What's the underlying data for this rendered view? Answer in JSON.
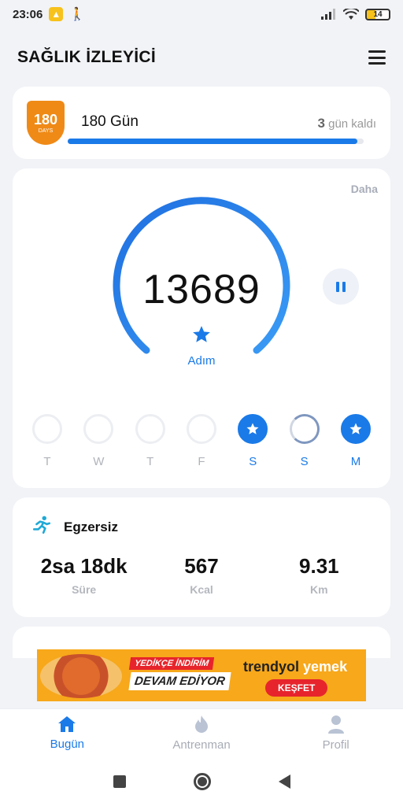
{
  "status_bar": {
    "time": "23:06",
    "battery": "14"
  },
  "header": {
    "title": "SAĞLIK İZLEYİCİ",
    "menu_icon": "hamburger-menu-icon"
  },
  "challenge": {
    "badge_number": "180",
    "badge_sub": "DAYS",
    "title": "180 Gün",
    "remaining_count": "3",
    "remaining_text": "gün kaldı",
    "progress": 0.98
  },
  "steps": {
    "more_label": "Daha",
    "count": "13689",
    "label": "Adım",
    "gauge_fraction": 1.0,
    "accent_color": "#1a7ae8",
    "days": [
      {
        "label": "T",
        "state": "empty"
      },
      {
        "label": "W",
        "state": "empty"
      },
      {
        "label": "T",
        "state": "empty"
      },
      {
        "label": "F",
        "state": "empty"
      },
      {
        "label": "S",
        "state": "done"
      },
      {
        "label": "S",
        "state": "partial"
      },
      {
        "label": "M",
        "state": "done"
      }
    ]
  },
  "exercise": {
    "title": "Egzersiz",
    "stats": [
      {
        "value": "2sa 18dk",
        "label": "Süre"
      },
      {
        "value": "567",
        "label": "Kcal"
      },
      {
        "value": "9.31",
        "label": "Km"
      }
    ]
  },
  "ad": {
    "line1": "YEDİKÇE İNDİRİM",
    "line2": "DEVAM EDİYOR",
    "brand_main": "trendyol",
    "brand_sub": "yemek",
    "cta": "KEŞFET"
  },
  "tabs": [
    {
      "label": "Bugün",
      "icon": "home-icon",
      "active": true
    },
    {
      "label": "Antrenman",
      "icon": "flame-icon",
      "active": false
    },
    {
      "label": "Profil",
      "icon": "person-icon",
      "active": false
    }
  ]
}
